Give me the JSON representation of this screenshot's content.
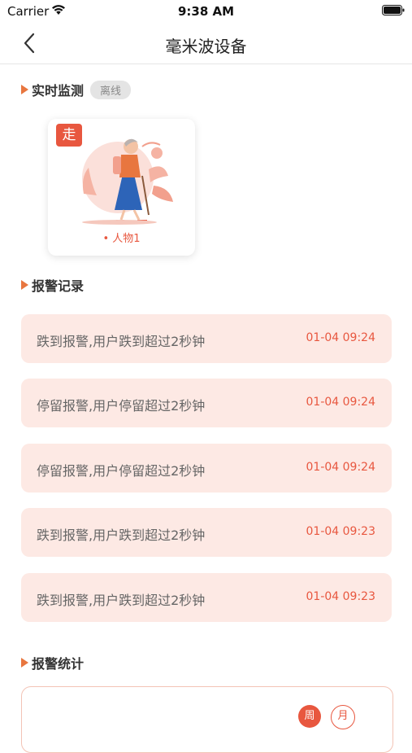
{
  "status_bar": {
    "carrier": "Carrier",
    "time": "9:38 AM"
  },
  "nav": {
    "title": "毫米波设备",
    "back_icon": "chevron-left-icon"
  },
  "realtime": {
    "title": "实时监测",
    "status_badge": "离线"
  },
  "person": {
    "state_tag": "走",
    "name": "• 人物1"
  },
  "alarms": {
    "title": "报警记录",
    "items": [
      {
        "text": "跌到报警,用户跌到超过2秒钟",
        "time": "01-04 09:24"
      },
      {
        "text": "停留报警,用户停留超过2秒钟",
        "time": "01-04 09:24"
      },
      {
        "text": "停留报警,用户停留超过2秒钟",
        "time": "01-04 09:24"
      },
      {
        "text": "跌到报警,用户跌到超过2秒钟",
        "time": "01-04 09:23"
      },
      {
        "text": "跌到报警,用户跌到超过2秒钟",
        "time": "01-04 09:23"
      }
    ]
  },
  "stats": {
    "title": "报警统计",
    "week": "周",
    "month": "月"
  },
  "colors": {
    "accent": "#e8573f",
    "item_bg": "#fde9e4",
    "triangle": "#e8763f"
  }
}
